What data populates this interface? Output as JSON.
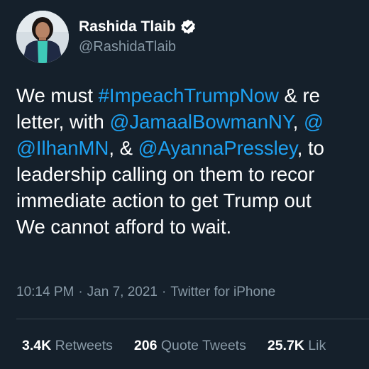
{
  "author": {
    "display_name": "Rashida Tlaib",
    "handle": "@RashidaTlaib",
    "verified_icon": "verified-badge-icon",
    "avatar_icon": "profile-avatar"
  },
  "tweet": {
    "line1": {
      "t1": "We must ",
      "tag1": "#ImpeachTrumpNow",
      "t2": " & re"
    },
    "line2": {
      "t1": "letter, with ",
      "m1": "@JamaalBowmanNY",
      "t2": ", ",
      "m2": "@"
    },
    "line3": {
      "m1": "@IlhanMN",
      "t1": ", & ",
      "m2": "@AyannaPressley",
      "t2": ", to"
    },
    "line4": "leadership calling on them to recor",
    "line5": "immediate action to get Trump out",
    "line6": "We cannot afford to wait."
  },
  "meta": {
    "time": "10:14 PM",
    "separator": "·",
    "date": "Jan 7, 2021",
    "source": "Twitter for iPhone"
  },
  "stats": {
    "retweets_count": "3.4K",
    "retweets_label": " Retweets",
    "quotes_count": "206",
    "quotes_label": " Quote Tweets",
    "likes_count": "25.7K",
    "likes_label": " Lik"
  },
  "colors": {
    "background": "#15202b",
    "link": "#1da1f2",
    "muted": "#8899a6",
    "divider": "#38444d"
  }
}
